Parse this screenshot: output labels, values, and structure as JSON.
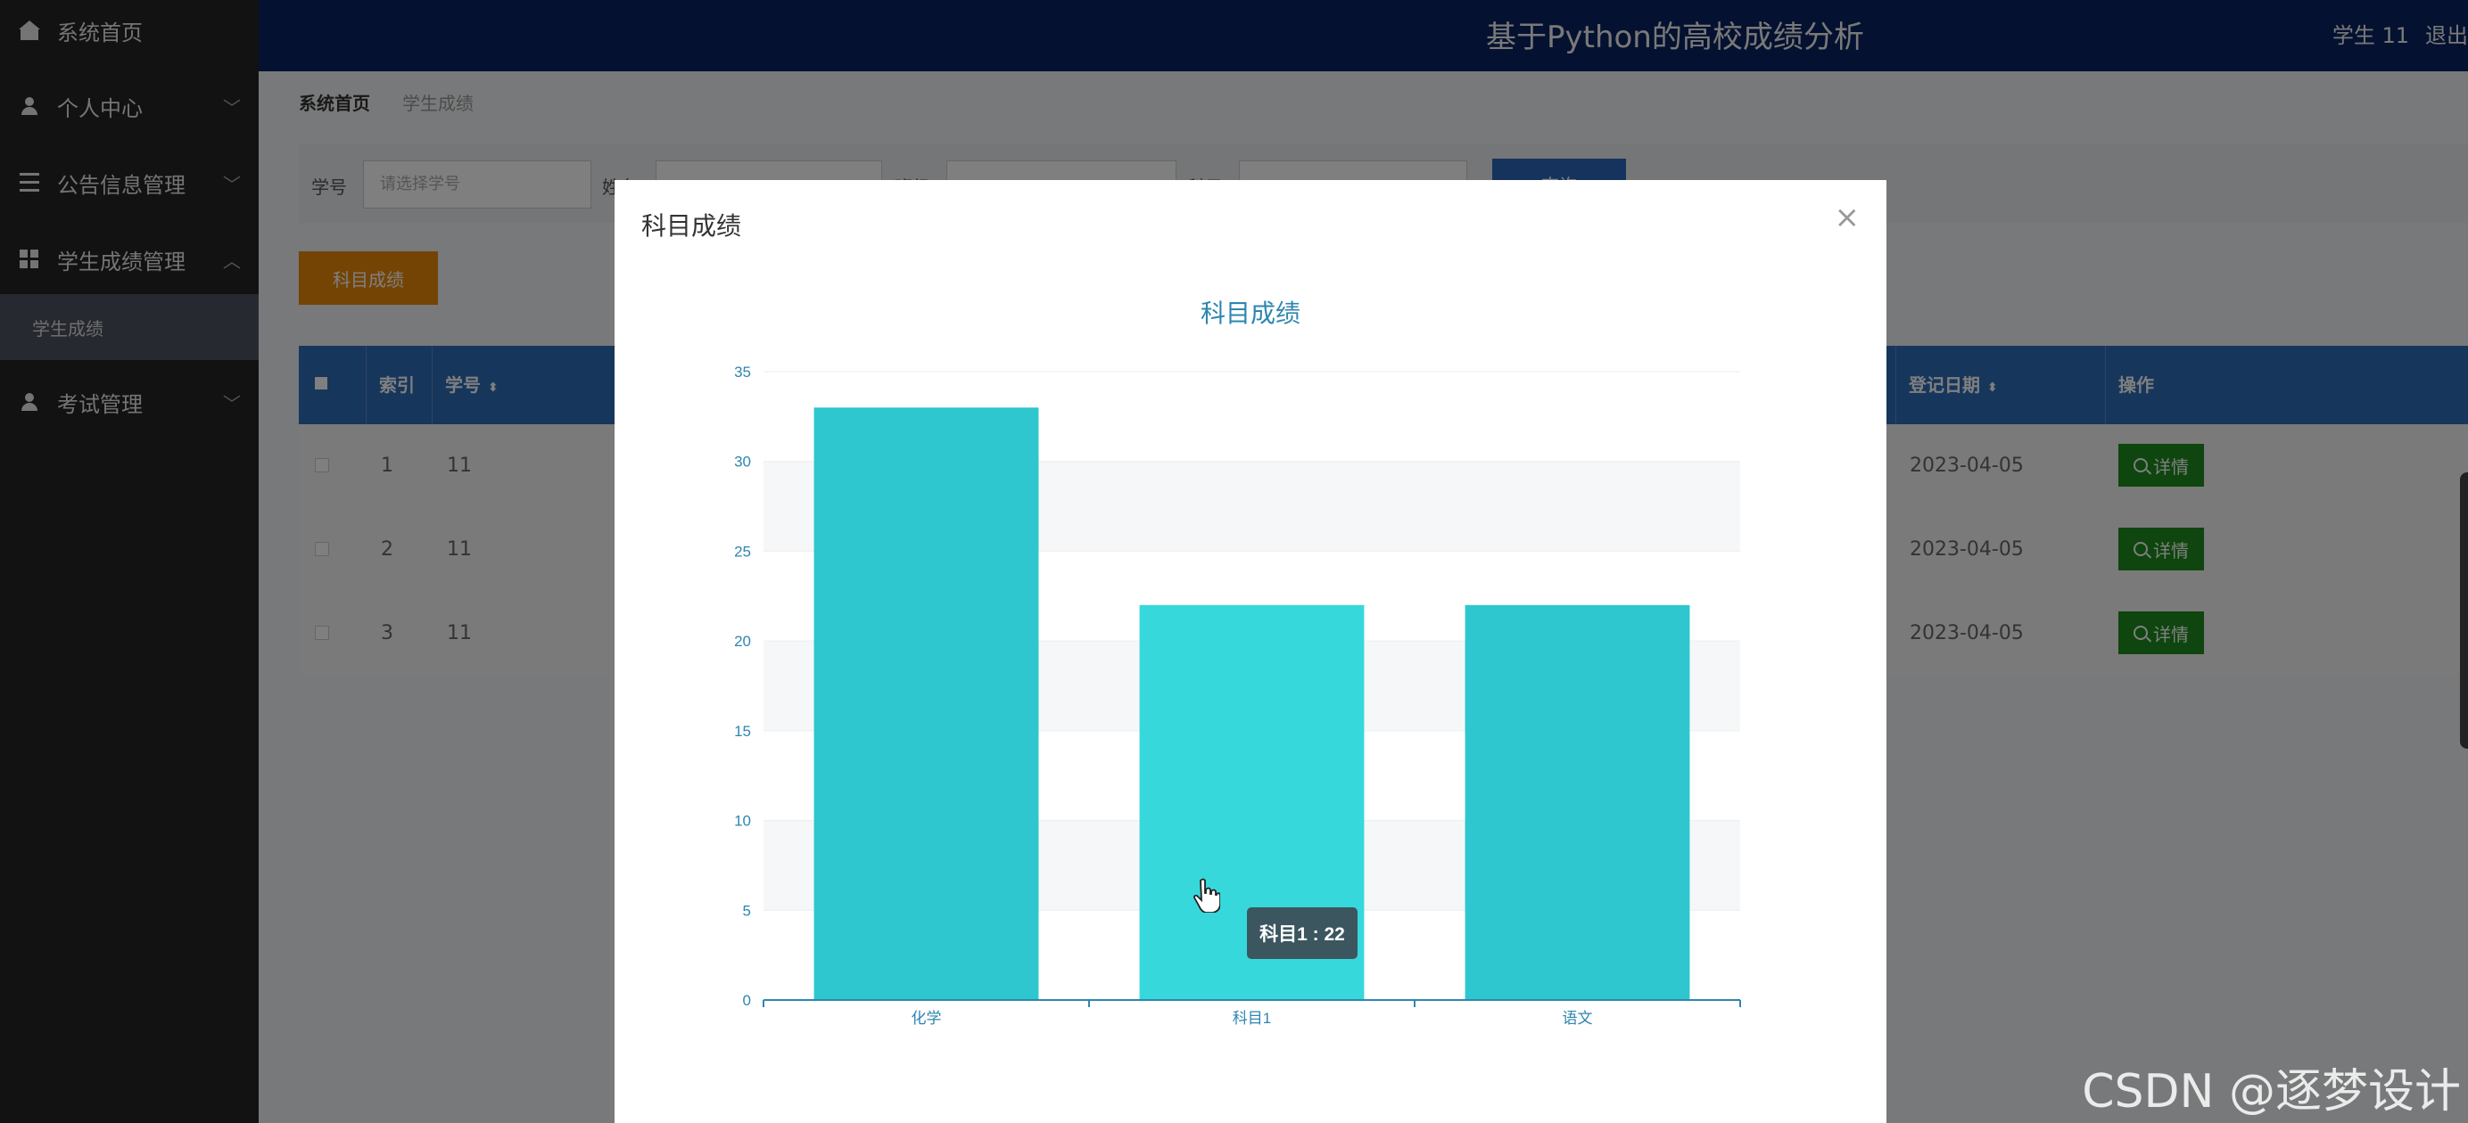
{
  "sidebar": {
    "items": [
      {
        "label": "系统首页",
        "icon": "home-icon"
      },
      {
        "label": "个人中心",
        "icon": "user-icon",
        "chevron": "﹀"
      },
      {
        "label": "公告信息管理",
        "icon": "list-icon",
        "chevron": "﹀"
      },
      {
        "label": "学生成绩管理",
        "icon": "grid-icon",
        "chevron": "︿"
      },
      {
        "label": "考试管理",
        "icon": "user-icon",
        "chevron": "﹀"
      }
    ],
    "sub_item": "学生成绩"
  },
  "header": {
    "title": "基于Python的高校成绩分析",
    "user": "学生 11",
    "logout": "退出"
  },
  "breadcrumb": {
    "home": "系统首页",
    "current": "学生成绩"
  },
  "search": {
    "label1": "学号",
    "placeholder1": "请选择学号",
    "label2": "姓名",
    "label3": "班级",
    "label4": "科目",
    "button": "查询"
  },
  "subject_button": "科目成绩",
  "table": {
    "headers": {
      "index": "索引",
      "student_id": "学号",
      "date": "登记日期",
      "action": "操作"
    },
    "rows": [
      {
        "index": "1",
        "student_id": "11",
        "date": "2023-04-05",
        "action": "详情"
      },
      {
        "index": "2",
        "student_id": "11",
        "date": "2023-04-05",
        "action": "详情"
      },
      {
        "index": "3",
        "student_id": "11",
        "date": "2023-04-05",
        "action": "详情"
      }
    ]
  },
  "modal": {
    "title": "科目成绩",
    "close": "×"
  },
  "chart_data": {
    "type": "bar",
    "title": "科目成绩",
    "categories": [
      "化学",
      "科目1",
      "语文"
    ],
    "values": [
      33,
      22,
      22
    ],
    "ylim": [
      0,
      35
    ],
    "yticks": [
      0,
      5,
      10,
      15,
      20,
      25,
      30,
      35
    ],
    "xlabel": "",
    "ylabel": "",
    "grid": "horizontal bands",
    "tooltip": "科目1 : 22",
    "colors": {
      "bar": "#2ec7cf",
      "bar_hover": "#36d8dc",
      "axis": "#2e86b0",
      "title": "#2e86b0"
    }
  },
  "watermark": "CSDN @逐梦设计",
  "colors": {
    "header": "#0a2360",
    "sidebar": "#242424",
    "primary": "#2f6cb8",
    "orange": "#e8880a",
    "green": "#1e8a1e"
  }
}
